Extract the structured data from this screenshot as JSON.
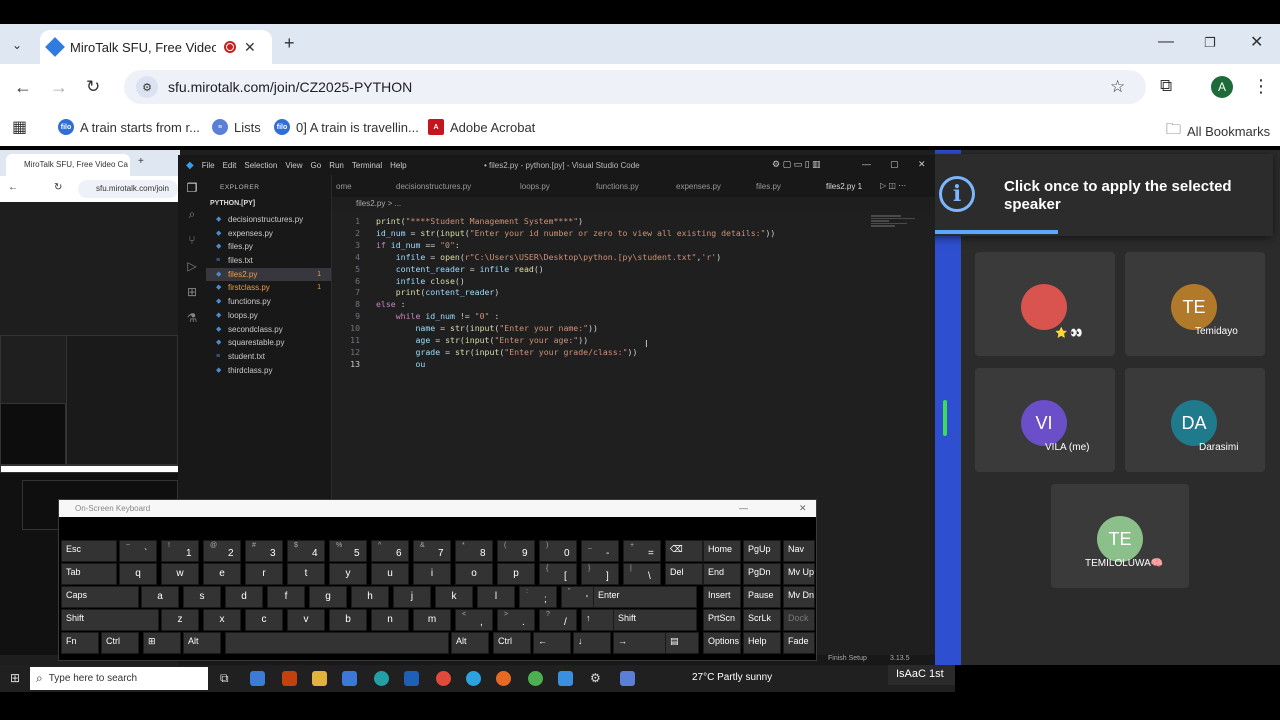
{
  "browser": {
    "tab_title": "MiroTalk SFU, Free Video Ca",
    "new_tab": "+",
    "url": "sfu.mirotalk.com/join/CZ2025-PYTHON",
    "avatar_letter": "A",
    "bookmarks": [
      {
        "label": "A train starts from r...",
        "icon": "filo"
      },
      {
        "label": "Lists",
        "icon": "lists"
      },
      {
        "label": "0] A train is travellin...",
        "icon": "filo"
      },
      {
        "label": "Adobe Acrobat",
        "icon": "acrobat"
      }
    ],
    "all_bookmarks": "All Bookmarks"
  },
  "nested_browser": {
    "tab_title": "MiroTalk SFU, Free Video Ca",
    "url": "sfu.mirotalk.com/join"
  },
  "vscode": {
    "menus": [
      "File",
      "Edit",
      "Selection",
      "View",
      "Go",
      "Run",
      "Terminal",
      "Help"
    ],
    "window_title": "• files2.py - python.[py] - Visual Studio Code",
    "explorer_header": "EXPLORER",
    "project": "PYTHON.[PY]",
    "files": [
      {
        "name": "decisionstructures.py",
        "state": ""
      },
      {
        "name": "expenses.py",
        "state": ""
      },
      {
        "name": "files.py",
        "state": ""
      },
      {
        "name": "files.txt",
        "state": ""
      },
      {
        "name": "files2.py",
        "state": "selected",
        "badge": "1"
      },
      {
        "name": "firstclass.py",
        "state": "error",
        "badge": "1"
      },
      {
        "name": "functions.py",
        "state": ""
      },
      {
        "name": "loops.py",
        "state": ""
      },
      {
        "name": "secondclass.py",
        "state": ""
      },
      {
        "name": "squarestable.py",
        "state": ""
      },
      {
        "name": "student.txt",
        "state": ""
      },
      {
        "name": "thirdclass.py",
        "state": ""
      }
    ],
    "tabs": [
      "ome",
      "decisionstructures.py",
      "loops.py",
      "functions.py",
      "expenses.py",
      "files.py",
      "files2.py 1"
    ],
    "breadcrumb": "files2.py > ...",
    "code_lines": [
      {
        "n": "1",
        "text": "print(\"****Student Management System****\")"
      },
      {
        "n": "2",
        "text": "id_num = str(input(\"Enter your id number or zero to view all existing details:\"))"
      },
      {
        "n": "3",
        "text": "if id_num == \"0\":"
      },
      {
        "n": "4",
        "text": "    infile = open(r\"C:\\Users\\USER\\Desktop\\python.[py\\student.txt\",'r')"
      },
      {
        "n": "5",
        "text": "    content_reader = infile.read()"
      },
      {
        "n": "6",
        "text": "    infile.close()"
      },
      {
        "n": "7",
        "text": "    print(content_reader)"
      },
      {
        "n": "8",
        "text": "else :"
      },
      {
        "n": "9",
        "text": "    while id_num != \"0\" :"
      },
      {
        "n": "10",
        "text": "        name = str(input(\"Enter your name:\"))"
      },
      {
        "n": "11",
        "text": "        age = str(input(\"Enter your age:\"))"
      },
      {
        "n": "12",
        "text": "        grade = str(input(\"Enter your grade/class:\"))"
      },
      {
        "n": "13",
        "text": "        ou"
      }
    ],
    "status_right": "Finish Setup",
    "status_version": "3.13.5"
  },
  "keyboard": {
    "title": "On-Screen Keyboard",
    "rows": [
      [
        [
          "Esc",
          ""
        ],
        [
          "`",
          "~"
        ],
        [
          "1",
          "!"
        ],
        [
          "2",
          "@"
        ],
        [
          "3",
          "#"
        ],
        [
          "4",
          "$"
        ],
        [
          "5",
          "%"
        ],
        [
          "6",
          "^"
        ],
        [
          "7",
          "&"
        ],
        [
          "8",
          "*"
        ],
        [
          "9",
          "("
        ],
        [
          "0",
          ")"
        ],
        [
          "-",
          "_"
        ],
        [
          "=",
          "+"
        ],
        [
          "⌫",
          ""
        ],
        [
          "Home",
          ""
        ],
        [
          "PgUp",
          ""
        ],
        [
          "Nav",
          ""
        ]
      ],
      [
        [
          "Tab",
          ""
        ],
        [
          "q",
          ""
        ],
        [
          "w",
          ""
        ],
        [
          "e",
          ""
        ],
        [
          "r",
          ""
        ],
        [
          "t",
          ""
        ],
        [
          "y",
          ""
        ],
        [
          "u",
          ""
        ],
        [
          "i",
          ""
        ],
        [
          "o",
          ""
        ],
        [
          "p",
          ""
        ],
        [
          "[",
          "{"
        ],
        [
          "]",
          "}"
        ],
        [
          "\\",
          "|"
        ],
        [
          "Del",
          ""
        ],
        [
          "End",
          ""
        ],
        [
          "PgDn",
          ""
        ],
        [
          "Mv Up",
          ""
        ]
      ],
      [
        [
          "Caps",
          ""
        ],
        [
          "a",
          ""
        ],
        [
          "s",
          ""
        ],
        [
          "d",
          ""
        ],
        [
          "f",
          ""
        ],
        [
          "g",
          ""
        ],
        [
          "h",
          ""
        ],
        [
          "j",
          ""
        ],
        [
          "k",
          ""
        ],
        [
          "l",
          ""
        ],
        [
          ";",
          ":"
        ],
        [
          "'",
          "\""
        ],
        [
          "Enter",
          ""
        ],
        [
          "Insert",
          ""
        ],
        [
          "Pause",
          ""
        ],
        [
          "Mv Dn",
          ""
        ]
      ],
      [
        [
          "Shift",
          ""
        ],
        [
          "z",
          ""
        ],
        [
          "x",
          ""
        ],
        [
          "c",
          ""
        ],
        [
          "v",
          ""
        ],
        [
          "b",
          ""
        ],
        [
          "n",
          ""
        ],
        [
          "m",
          ""
        ],
        [
          ",",
          "<"
        ],
        [
          ".",
          ">"
        ],
        [
          "/",
          "?"
        ],
        [
          "↑",
          ""
        ],
        [
          "Shift",
          ""
        ],
        [
          "PrtScn",
          ""
        ],
        [
          "ScrLk",
          ""
        ],
        [
          "Dock",
          ""
        ]
      ],
      [
        [
          "Fn",
          ""
        ],
        [
          "Ctrl",
          ""
        ],
        [
          "⊞",
          ""
        ],
        [
          "Alt",
          ""
        ],
        [
          "",
          ""
        ],
        [
          "Alt",
          ""
        ],
        [
          "Ctrl",
          ""
        ],
        [
          "←",
          ""
        ],
        [
          "↓",
          ""
        ],
        [
          "→",
          ""
        ],
        [
          "▤",
          ""
        ],
        [
          "Options",
          ""
        ],
        [
          "Help",
          ""
        ],
        [
          "Fade",
          ""
        ]
      ]
    ]
  },
  "notification": {
    "text": "Click once to apply the selected speaker"
  },
  "participants": [
    {
      "initials": "",
      "name": "⭐ 👀",
      "color": "#d9534f"
    },
    {
      "initials": "TE",
      "name": "Temidayo",
      "color": "#b07a2a"
    },
    {
      "initials": "VI",
      "name": "VILA (me)",
      "color": "#6a4fc9"
    },
    {
      "initials": "DA",
      "name": "Darasimi",
      "color": "#1f7a8c"
    },
    {
      "initials": "TE",
      "name": "TEMILOLUWA🧠",
      "color": "#8cc08a"
    }
  ],
  "taskbar": {
    "search_placeholder": "Type here to search",
    "weather": "27°C  Partly sunny",
    "user_label": "IsAaC 1st"
  }
}
